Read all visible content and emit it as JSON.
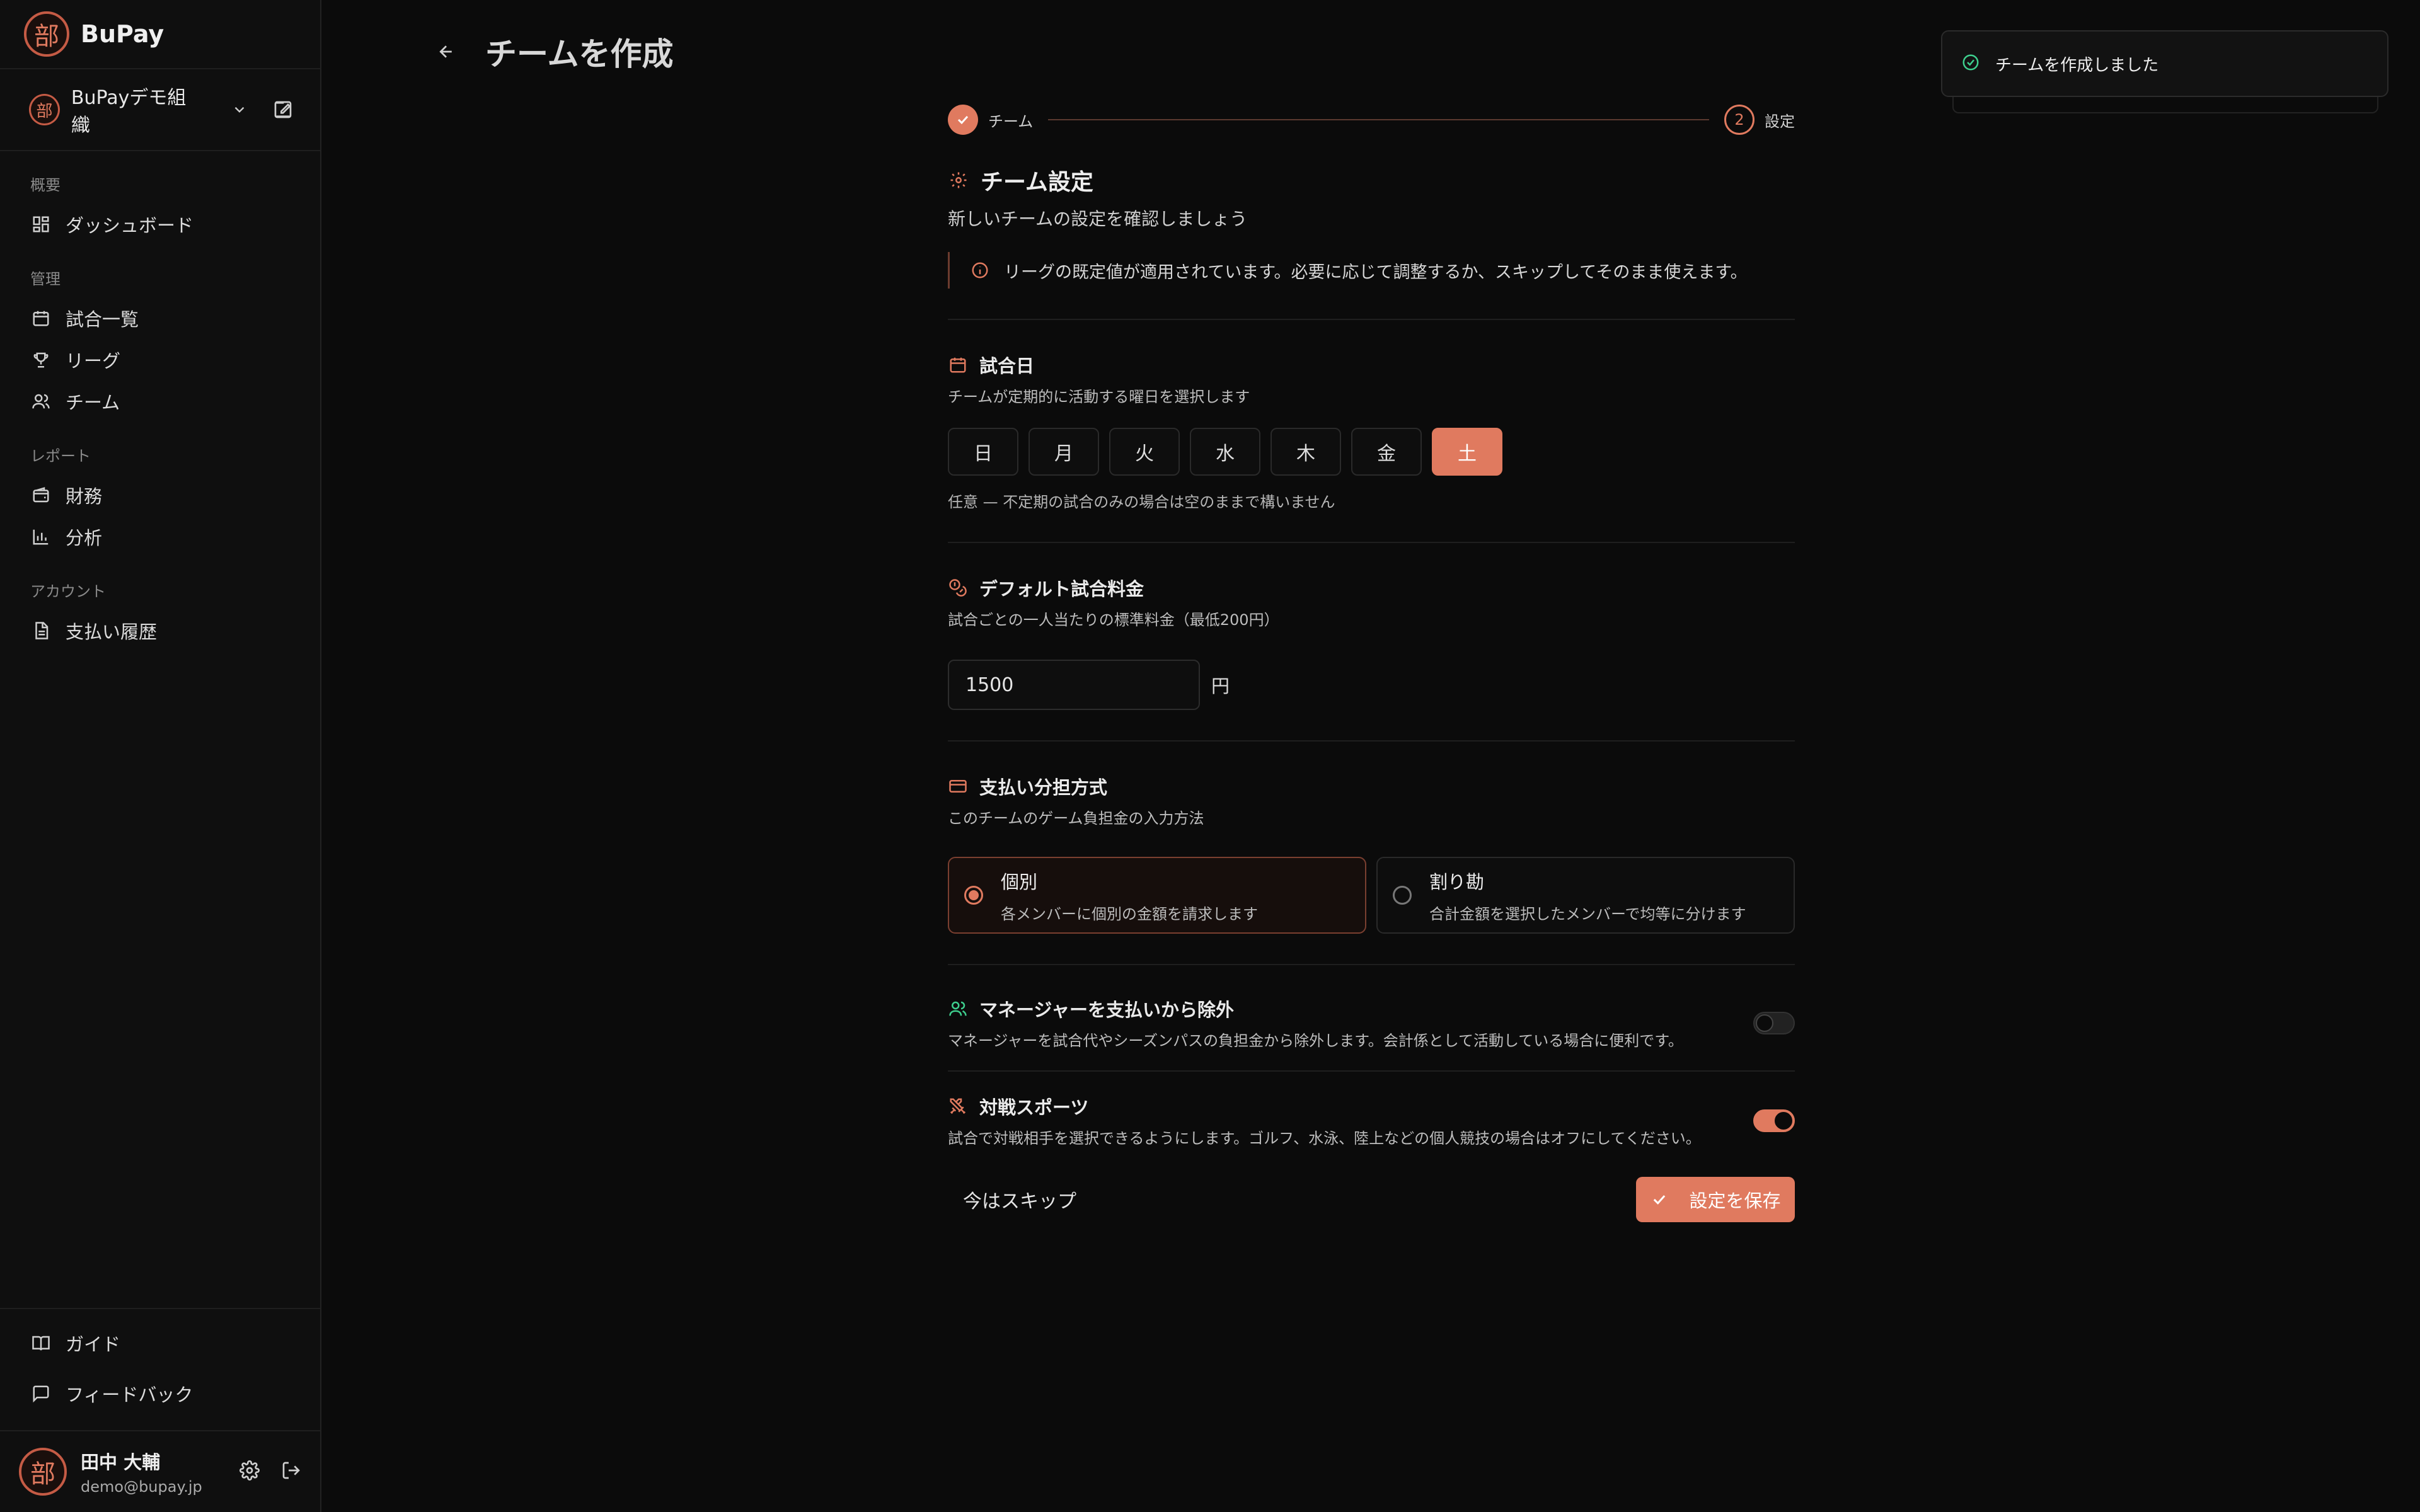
{
  "app": {
    "name": "BuPay",
    "logo_char": "部"
  },
  "org": {
    "name": "BuPayデモ組織"
  },
  "sidebar": {
    "groups": [
      {
        "title": "概要",
        "items": [
          {
            "label": "ダッシュボード"
          }
        ]
      },
      {
        "title": "管理",
        "items": [
          {
            "label": "試合一覧"
          },
          {
            "label": "リーグ"
          },
          {
            "label": "チーム"
          }
        ]
      },
      {
        "title": "レポート",
        "items": [
          {
            "label": "財務"
          },
          {
            "label": "分析"
          }
        ]
      },
      {
        "title": "アカウント",
        "items": [
          {
            "label": "支払い履歴"
          }
        ]
      }
    ],
    "bottom": [
      {
        "label": "ガイド"
      },
      {
        "label": "フィードバック"
      }
    ]
  },
  "user": {
    "name": "田中 大輔",
    "email": "demo@bupay.jp"
  },
  "page": {
    "title": "チームを作成"
  },
  "toast": {
    "text": "チームを作成しました"
  },
  "stepper": {
    "step1": "チーム",
    "step2_num": "2",
    "step2": "設定"
  },
  "settings": {
    "title": "チーム設定",
    "desc": "新しいチームの設定を確認しましょう",
    "alert": "リーグの既定値が適用されています。必要に応じて調整するか、スキップしてそのまま使えます。"
  },
  "match_days": {
    "title": "試合日",
    "desc": "チームが定期的に活動する曜日を選択します",
    "days": [
      "日",
      "月",
      "火",
      "水",
      "木",
      "金",
      "土"
    ],
    "selected": "土",
    "hint": "任意 — 不定期の試合のみの場合は空のままで構いません"
  },
  "fee": {
    "title": "デフォルト試合料金",
    "desc": "試合ごとの一人当たりの標準料金（最低200円）",
    "value": "1500",
    "unit": "円"
  },
  "split": {
    "title": "支払い分担方式",
    "desc": "このチームのゲーム負担金の入力方法",
    "options": [
      {
        "label": "個別",
        "desc": "各メンバーに個別の金額を請求します",
        "selected": true
      },
      {
        "label": "割り勘",
        "desc": "合計金額を選択したメンバーで均等に分けます",
        "selected": false
      }
    ]
  },
  "exclude_manager": {
    "title": "マネージャーを支払いから除外",
    "desc": "マネージャーを試合代やシーズンパスの負担金から除外します。会計係として活動している場合に便利です。",
    "on": false
  },
  "versus": {
    "title": "対戦スポーツ",
    "desc": "試合で対戦相手を選択できるようにします。ゴルフ、水泳、陸上などの個人競技の場合はオフにしてください。",
    "on": true
  },
  "actions": {
    "skip": "今はスキップ",
    "save": "設定を保存"
  },
  "colors": {
    "accent": "#e07a5f",
    "background": "#0b0b0b",
    "success": "#3ecf8e"
  }
}
